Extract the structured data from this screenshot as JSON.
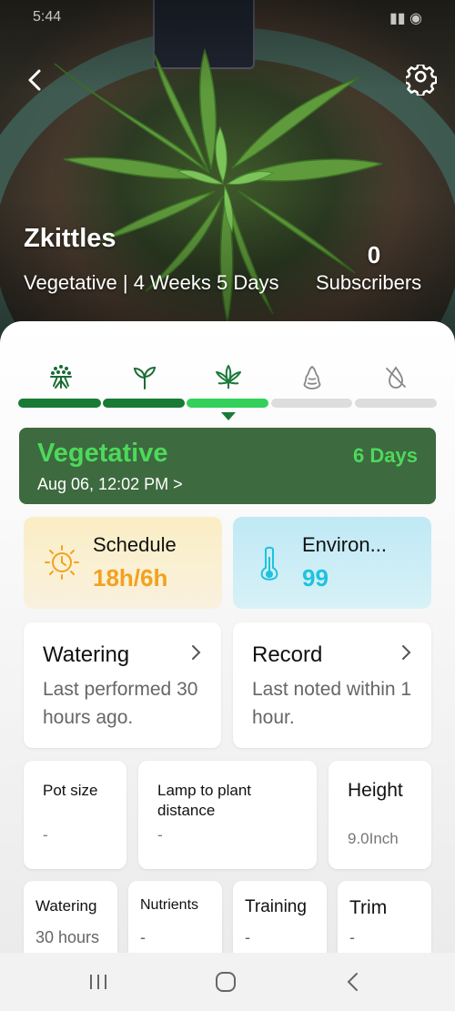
{
  "status_bar": {
    "time": "5:44",
    "right": ""
  },
  "header": {
    "plant_name": "Zkittles",
    "stage_summary": "Vegetative | 4 Weeks 5 Days",
    "subscribers_count": "0",
    "subscribers_label": "Subscribers"
  },
  "stages": {
    "items": [
      "germination",
      "seedling",
      "vegetative",
      "flowering",
      "harvest"
    ],
    "current_index": 2,
    "colors": {
      "done": "#197a34",
      "current": "#33d05a",
      "pending": "#dddddd"
    }
  },
  "current_stage": {
    "title": "Vegetative",
    "date": "Aug 06, 12:02 PM >",
    "days": "6 Days"
  },
  "schedule": {
    "title": "Schedule",
    "value": "18h/6h",
    "color": "#f2a21d"
  },
  "environment": {
    "title": "Environ...",
    "value": "99",
    "color": "#1ec2de"
  },
  "watering": {
    "title": "Watering",
    "subtitle": "Last performed 30 hours ago."
  },
  "record": {
    "title": "Record",
    "subtitle": "Last noted within 1 hour."
  },
  "info": {
    "pot_size": {
      "label": "Pot size",
      "value": "-"
    },
    "lamp_distance": {
      "label": "Lamp to plant distance",
      "value": "-"
    },
    "height": {
      "label": "Height",
      "value": "9.0Inch"
    }
  },
  "activities": [
    {
      "label": "Watering",
      "value": "30 hours"
    },
    {
      "label": "Nutrients",
      "value": "-"
    },
    {
      "label": "Training",
      "value": "-"
    },
    {
      "label": "Trim",
      "value": "-"
    }
  ]
}
